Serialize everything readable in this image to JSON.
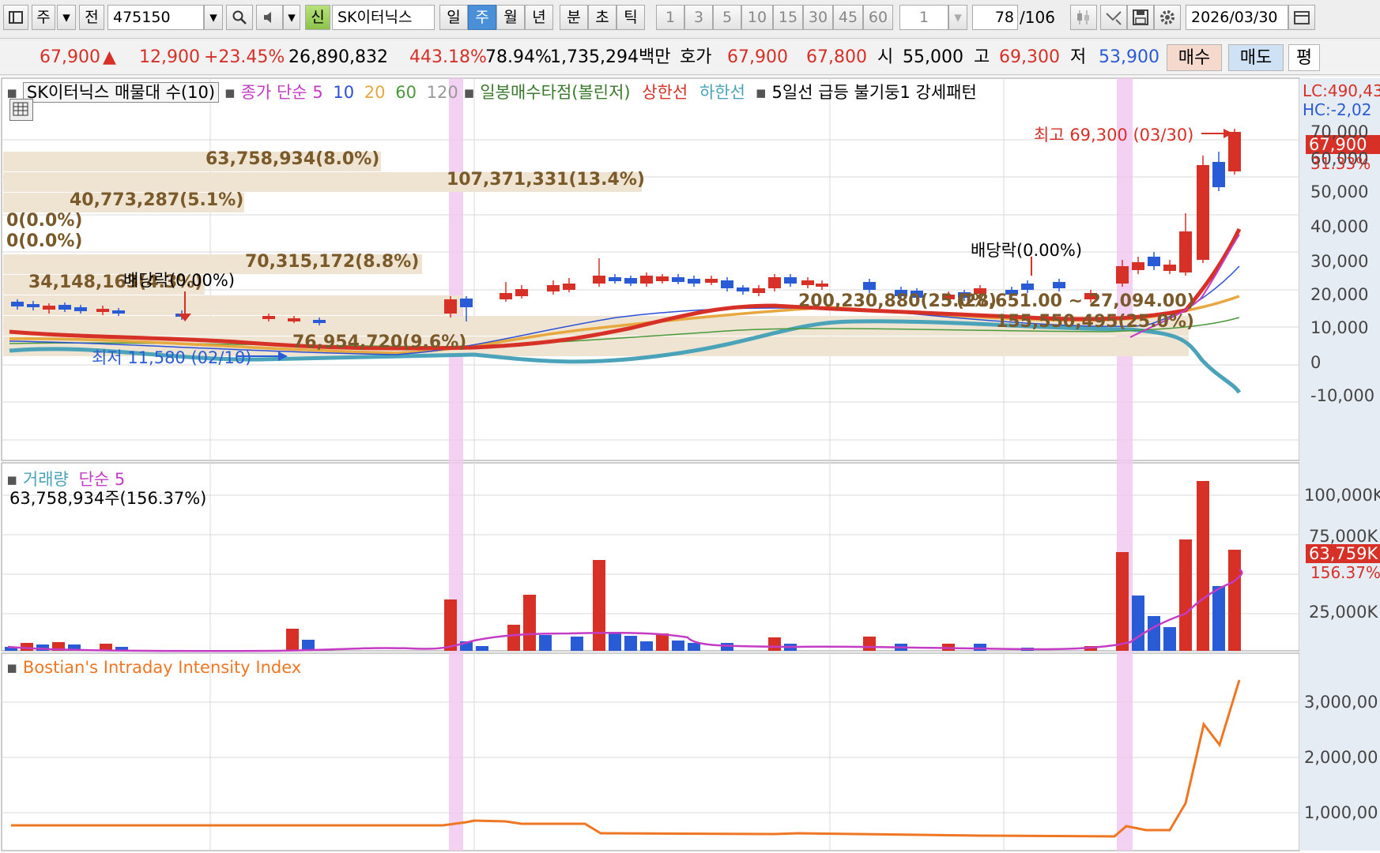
{
  "toolbar": {
    "type_label": "주",
    "prev_label": "전",
    "code": "475150",
    "new_badge": "신",
    "stock_name": "SK이터닉스",
    "periods": [
      "일",
      "주",
      "월",
      "년"
    ],
    "minute_units": [
      "분",
      "초",
      "틱"
    ],
    "intervals": [
      "1",
      "3",
      "5",
      "10",
      "15",
      "30",
      "45",
      "60"
    ],
    "interval_select": "1",
    "page_current": "78",
    "page_total": "/106",
    "date": "2026/03/30"
  },
  "quote": {
    "price": "67,900",
    "change_arrow": "▲",
    "change": "12,900",
    "change_pct": "+23.45%",
    "volume": "26,890,832",
    "volume_ratio": "443.18%",
    "turnover": "78.94%",
    "amount": "1,735,294백만",
    "hoga_label": "호가",
    "ask": "67,900",
    "bid": "67,800",
    "open_label": "시",
    "open": "55,000",
    "high_label": "고",
    "high": "69,300",
    "low_label": "저",
    "low": "53,900",
    "buy_label": "매수",
    "sell_label": "매도",
    "flat_label": "평"
  },
  "legend": {
    "title": "SK이터닉스 매물대 수(10)",
    "ma_label": "종가 단순",
    "ma_periods": [
      "5",
      "10",
      "20",
      "60",
      "120"
    ],
    "bollinger": "일봉매수타점(볼린저)",
    "upper": "상한선",
    "lower": "하한선",
    "pattern": "5일선 급등 불기둥1 강세패턴"
  },
  "right_info": {
    "lc": "LC:490,43",
    "hc": "HC:-2,02"
  },
  "volume_profile": [
    "63,758,934(8.0%)",
    "107,371,331(13.4%)",
    "40,773,287(5.1%)",
    "0(0.0%)",
    "0(0.0%)",
    "70,315,172(8.8%)",
    "34,148,163(4.3%)",
    "76,954,720(9.6%)",
    "200,230,880(25.0%)",
    "155,550,495(25.0%)"
  ],
  "annotations": {
    "high": "최고 69,300 (03/30)",
    "low": "최저 11,580 (02/10)",
    "dividend1": "배당락(0.00%)",
    "dividend2": "배당락(0.00%)",
    "range": "(28,651.00 ~ 27,094.00)"
  },
  "price_axis": {
    "ticks": [
      "70,000",
      "60,000",
      "50,000",
      "40,000",
      "30,000",
      "20,000",
      "10,000",
      "0",
      "-10,000"
    ],
    "current": "67,900",
    "current_pct": "31.33%"
  },
  "volume_panel": {
    "title": "거래량",
    "ma": "단순 5",
    "value": "63,758,934주(156.37%)",
    "ticks": [
      "100,000K",
      "75,000K",
      "25,000K"
    ],
    "current": "63,759K",
    "current_pct": "156.37%"
  },
  "biii_panel": {
    "title": "Bostian's Intraday Intensity Index",
    "ticks": [
      "3,000,00",
      "2,000,00",
      "1,000,00"
    ]
  },
  "colors": {
    "up": "#d73027",
    "down": "#2a5bd7",
    "ma5": "#c43cc4",
    "lower": "#4aa3b8",
    "accent": "#d73027"
  }
}
